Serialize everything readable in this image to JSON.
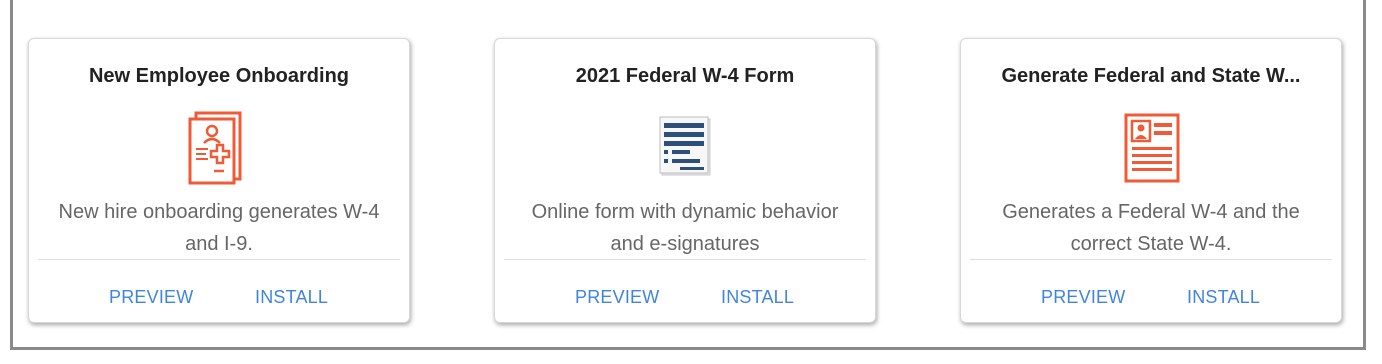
{
  "cards": [
    {
      "title": "New Employee Onboarding",
      "description": "New hire onboarding generates W-4 and I-9.",
      "icon": "medical-document-icon",
      "preview_label": "PREVIEW",
      "install_label": "INSTALL"
    },
    {
      "title": "2021 Federal W-4 Form",
      "description": "Online form with dynamic behavior and e-signatures",
      "icon": "form-document-icon",
      "preview_label": "PREVIEW",
      "install_label": "INSTALL"
    },
    {
      "title": "Generate Federal and State W...",
      "description": "Generates a Federal W-4 and the correct State W-4.",
      "icon": "profile-document-icon",
      "preview_label": "PREVIEW",
      "install_label": "INSTALL"
    }
  ],
  "colors": {
    "accent": "#3f85e0",
    "icon_orange": "#f05a36",
    "icon_blue": "#2d4f7c"
  }
}
